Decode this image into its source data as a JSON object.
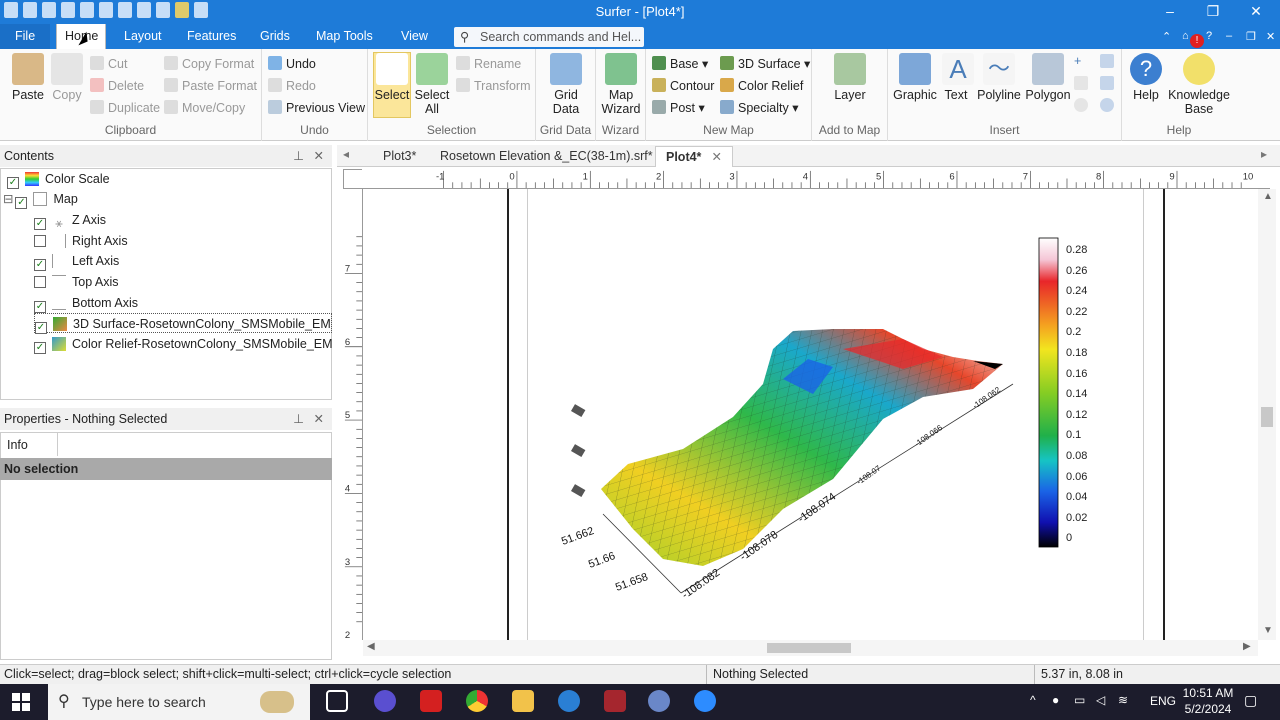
{
  "window": {
    "title": "Surfer - [Plot4*]"
  },
  "menu_tabs": [
    "File",
    "Home",
    "Layout",
    "Features",
    "Grids",
    "Map Tools",
    "View"
  ],
  "search": {
    "placeholder": "Search commands and Hel..."
  },
  "clipboard": {
    "paste": "Paste",
    "copy": "Copy",
    "cut": "Cut",
    "delete": "Delete",
    "duplicate": "Duplicate",
    "copy_format": "Copy Format",
    "paste_format": "Paste Format",
    "move_copy": "Move/Copy",
    "label": "Clipboard"
  },
  "undo": {
    "undo": "Undo",
    "redo": "Redo",
    "previous_view": "Previous View",
    "label": "Undo"
  },
  "selection": {
    "select": "Select",
    "select_all": "Select All",
    "rename": "Rename",
    "transform": "Transform",
    "label": "Selection"
  },
  "grid_data": {
    "button": "Grid Data",
    "label": "Grid Data"
  },
  "wizard": {
    "button": "Map Wizard",
    "label": "Wizard"
  },
  "new_map": {
    "base": "Base",
    "contour": "Contour",
    "post": "Post",
    "surface3d": "3D Surface",
    "color_relief": "Color Relief",
    "specialty": "Specialty",
    "label": "New Map"
  },
  "add_to_map": {
    "layer": "Layer",
    "label": "Add to Map"
  },
  "insert": {
    "graphic": "Graphic",
    "text": "Text",
    "polyline": "Polyline",
    "polygon": "Polygon",
    "label": "Insert"
  },
  "help": {
    "help": "Help",
    "kb": "Knowledge Base",
    "label": "Help"
  },
  "contents": {
    "title": "Contents",
    "items": [
      {
        "label": "Color Scale",
        "checked": true,
        "level": 0
      },
      {
        "label": "Map",
        "checked": true,
        "level": 0
      },
      {
        "label": "Z Axis",
        "checked": true,
        "level": 1
      },
      {
        "label": "Right Axis",
        "checked": false,
        "level": 1
      },
      {
        "label": "Left Axis",
        "checked": true,
        "level": 1
      },
      {
        "label": "Top Axis",
        "checked": false,
        "level": 1
      },
      {
        "label": "Bottom Axis",
        "checked": true,
        "level": 1
      },
      {
        "label": "3D Surface-RosetownColony_SMSMobile_EM",
        "checked": true,
        "level": 1
      },
      {
        "label": "Color Relief-RosetownColony_SMSMobile_EM",
        "checked": true,
        "level": 1
      }
    ]
  },
  "properties": {
    "title": "Properties - Nothing Selected",
    "tab": "Info",
    "body": "No selection"
  },
  "doc_tabs": [
    "Plot3*",
    "Rosetown Elevation &_EC(38-1m).srf*",
    "Plot4*"
  ],
  "rulers": {
    "h": [
      "-1",
      "0",
      "1",
      "2",
      "3",
      "4",
      "5",
      "6",
      "7",
      "8",
      "9",
      "10"
    ],
    "v": [
      "7",
      "6",
      "5",
      "4",
      "3",
      "2"
    ]
  },
  "color_scale": {
    "labels": [
      "0.28",
      "0.26",
      "0.24",
      "0.22",
      "0.2",
      "0.18",
      "0.16",
      "0.14",
      "0.12",
      "0.1",
      "0.08",
      "0.06",
      "0.04",
      "0.02",
      "0"
    ]
  },
  "axes": {
    "y_ticks": [
      "51.662",
      "51.66",
      "51.658"
    ],
    "x_ticks": [
      "-108.082",
      "-108.078",
      "-108.074",
      "-108.07",
      "-108.066",
      "-108.062"
    ]
  },
  "status": {
    "hint": "Click=select; drag=block select; shift+click=multi-select; ctrl+click=cycle selection",
    "selection": "Nothing Selected",
    "coords": "5.37 in, 8.08 in"
  },
  "taskbar": {
    "search": "Type here to search",
    "lang": "ENG",
    "time": "10:51 AM",
    "date": "5/2/2024"
  }
}
